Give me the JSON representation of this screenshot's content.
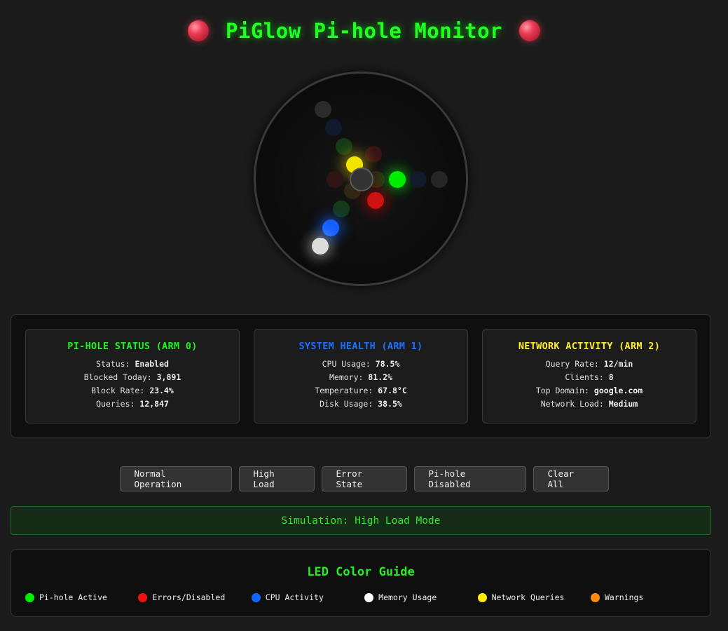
{
  "header": {
    "title": "PiGlow Pi-hole Monitor"
  },
  "leds": [
    {
      "arm": 0,
      "color": "#00ff00",
      "lit": true
    },
    {
      "arm": 1,
      "color": "#0a60ff",
      "lit": true
    },
    {
      "arm": 1,
      "color": "#f0f0f0",
      "lit": true
    },
    {
      "arm": 2,
      "color": "#ffee00",
      "lit": true
    },
    {
      "arm": 2,
      "color": "#ff1a1a",
      "lit": true
    }
  ],
  "arms": [
    {
      "title": "PI-HOLE STATUS (ARM 0)",
      "title_color": "#22ee22",
      "rows": [
        {
          "label": "Status:",
          "value": "Enabled"
        },
        {
          "label": "Blocked Today:",
          "value": "3,891"
        },
        {
          "label": "Block Rate:",
          "value": "23.4%"
        },
        {
          "label": "Queries:",
          "value": "12,847"
        }
      ]
    },
    {
      "title": "SYSTEM HEALTH (ARM 1)",
      "title_color": "#1f6fff",
      "rows": [
        {
          "label": "CPU Usage:",
          "value": "78.5%"
        },
        {
          "label": "Memory:",
          "value": "81.2%"
        },
        {
          "label": "Temperature:",
          "value": "67.8°C"
        },
        {
          "label": "Disk Usage:",
          "value": "38.5%"
        }
      ]
    },
    {
      "title": "NETWORK ACTIVITY (ARM 2)",
      "title_color": "#ffee22",
      "rows": [
        {
          "label": "Query Rate:",
          "value": "12/min"
        },
        {
          "label": "Clients:",
          "value": "8"
        },
        {
          "label": "Top Domain:",
          "value": "google.com"
        },
        {
          "label": "Network Load:",
          "value": "Medium"
        }
      ]
    }
  ],
  "controls": {
    "normal": "Normal Operation",
    "high_load": "High Load",
    "error": "Error State",
    "disabled": "Pi-hole Disabled",
    "clear": "Clear All"
  },
  "status": "Simulation: High Load Mode",
  "guide": {
    "title": "LED Color Guide",
    "items": [
      {
        "color": "#00ee00",
        "label": "Pi-hole Active"
      },
      {
        "color": "#ee1111",
        "label": "Errors/Disabled"
      },
      {
        "color": "#1166ff",
        "label": "CPU Activity"
      },
      {
        "color": "#ffffff",
        "label": "Memory Usage"
      },
      {
        "color": "#ffee00",
        "label": "Network Queries"
      },
      {
        "color": "#ff8811",
        "label": "Warnings"
      }
    ]
  }
}
